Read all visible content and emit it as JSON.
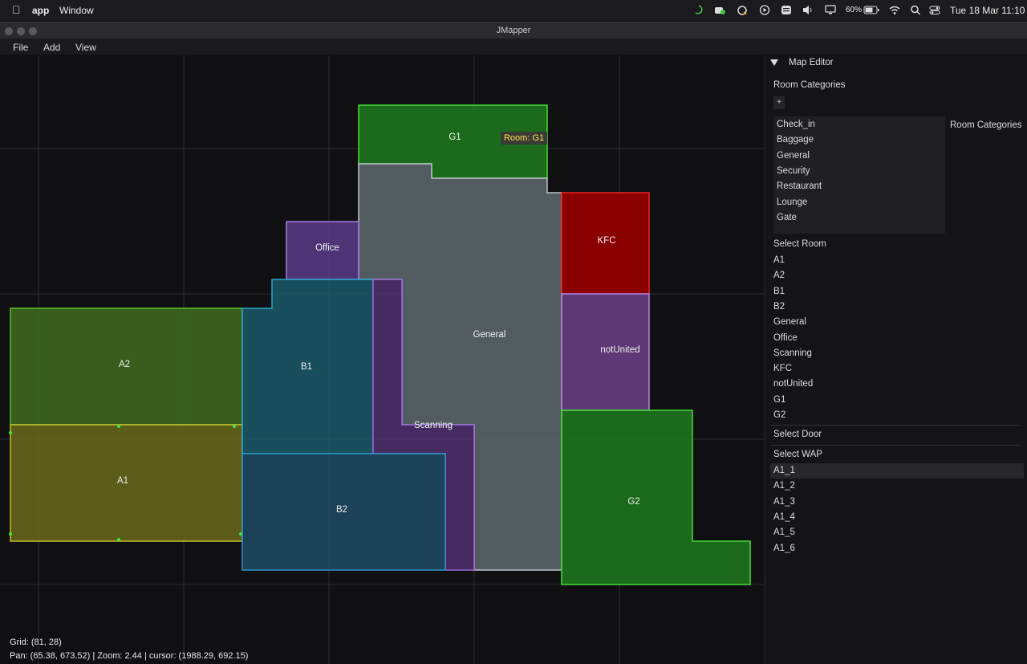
{
  "menubar": {
    "apple": "",
    "app": "app",
    "window": "Window",
    "battery": "60%",
    "datetime": "Tue 18 Mar  11:10"
  },
  "window": {
    "title": "JMapper"
  },
  "appmenu": {
    "file": "File",
    "add": "Add",
    "view": "View"
  },
  "canvas": {
    "tooltip": "Room: G1",
    "grid_status": "Grid: (81, 28)",
    "pan_status": "Pan: (65.38, 673.52) | Zoom: 2.44 | cursor: (1988.29, 692.15)",
    "rooms": [
      {
        "name": "G1",
        "color": "#1f7a1f",
        "stroke": "#44dd33"
      },
      {
        "name": "General",
        "color": "#5e6a6e",
        "stroke": "#b9c4c8"
      },
      {
        "name": "Office",
        "color": "#5b3a8a",
        "stroke": "#a67ae0"
      },
      {
        "name": "KFC",
        "color": "#8a0000",
        "stroke": "#ee2222"
      },
      {
        "name": "notUnited",
        "color": "#6b3f86",
        "stroke": "#b184e0"
      },
      {
        "name": "A2",
        "color": "#3f6b1f",
        "stroke": "#5ec02a"
      },
      {
        "name": "A1",
        "color": "#6a6a1c",
        "stroke": "#c3c02a"
      },
      {
        "name": "B1",
        "color": "#1b5b6a",
        "stroke": "#27a6c9"
      },
      {
        "name": "Scanning",
        "color": "#4f3070",
        "stroke": "#9a6ad8"
      },
      {
        "name": "B2",
        "color": "#1e4a66",
        "stroke": "#2a95c4"
      },
      {
        "name": "G2",
        "color": "#1f7a1f",
        "stroke": "#44dd33"
      }
    ]
  },
  "panel": {
    "header": "Map Editor",
    "room_categories_label": "Room Categories",
    "add_button": "+",
    "categories_side_label": "Room Categories",
    "categories": [
      "Check_in",
      "Baggage",
      "General",
      "Security",
      "Restaurant",
      "Lounge",
      "Gate"
    ],
    "select_room_label": "Select Room",
    "rooms": [
      "A1",
      "A2",
      "B1",
      "B2",
      "General",
      "Office",
      "Scanning",
      "KFC",
      "notUnited",
      "G1",
      "G2"
    ],
    "select_door_label": "Select Door",
    "select_wap_label": "Select WAP",
    "waps": [
      "A1_1",
      "A1_2",
      "A1_3",
      "A1_4",
      "A1_5",
      "A1_6"
    ]
  }
}
